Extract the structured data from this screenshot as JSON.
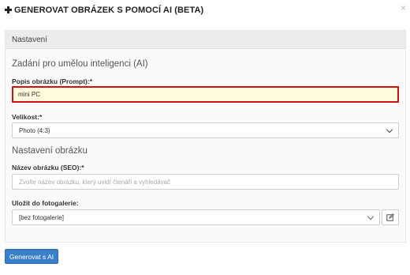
{
  "modal": {
    "title": "GENEROVAT OBRÁZEK S POMOCÍ AI (BETA)",
    "close_label": "×"
  },
  "panel": {
    "heading": "Nastavení",
    "ai_section_title": "Zadání pro umělou inteligenci (AI)",
    "image_section_title": "Nastavení obrázku"
  },
  "fields": {
    "prompt": {
      "label": "Popis obrázku (Prompt):*",
      "value": "mini PC"
    },
    "size": {
      "label": "Velikost:*",
      "value": "Photo (4:3)"
    },
    "seo": {
      "label": "Název obrázku (SEO):*",
      "placeholder": "Zvolte název obrázku, který uvidí čtenáři a vyhledávač"
    },
    "gallery": {
      "label": "Uložit do fotogalerie:",
      "value": "[bez fotogalerie]"
    }
  },
  "actions": {
    "submit_label": "Generovat s AI"
  },
  "colors": {
    "primary": "#3a7fc9",
    "error_border": "#d40f14",
    "prompt_bg": "#fffbdc"
  }
}
